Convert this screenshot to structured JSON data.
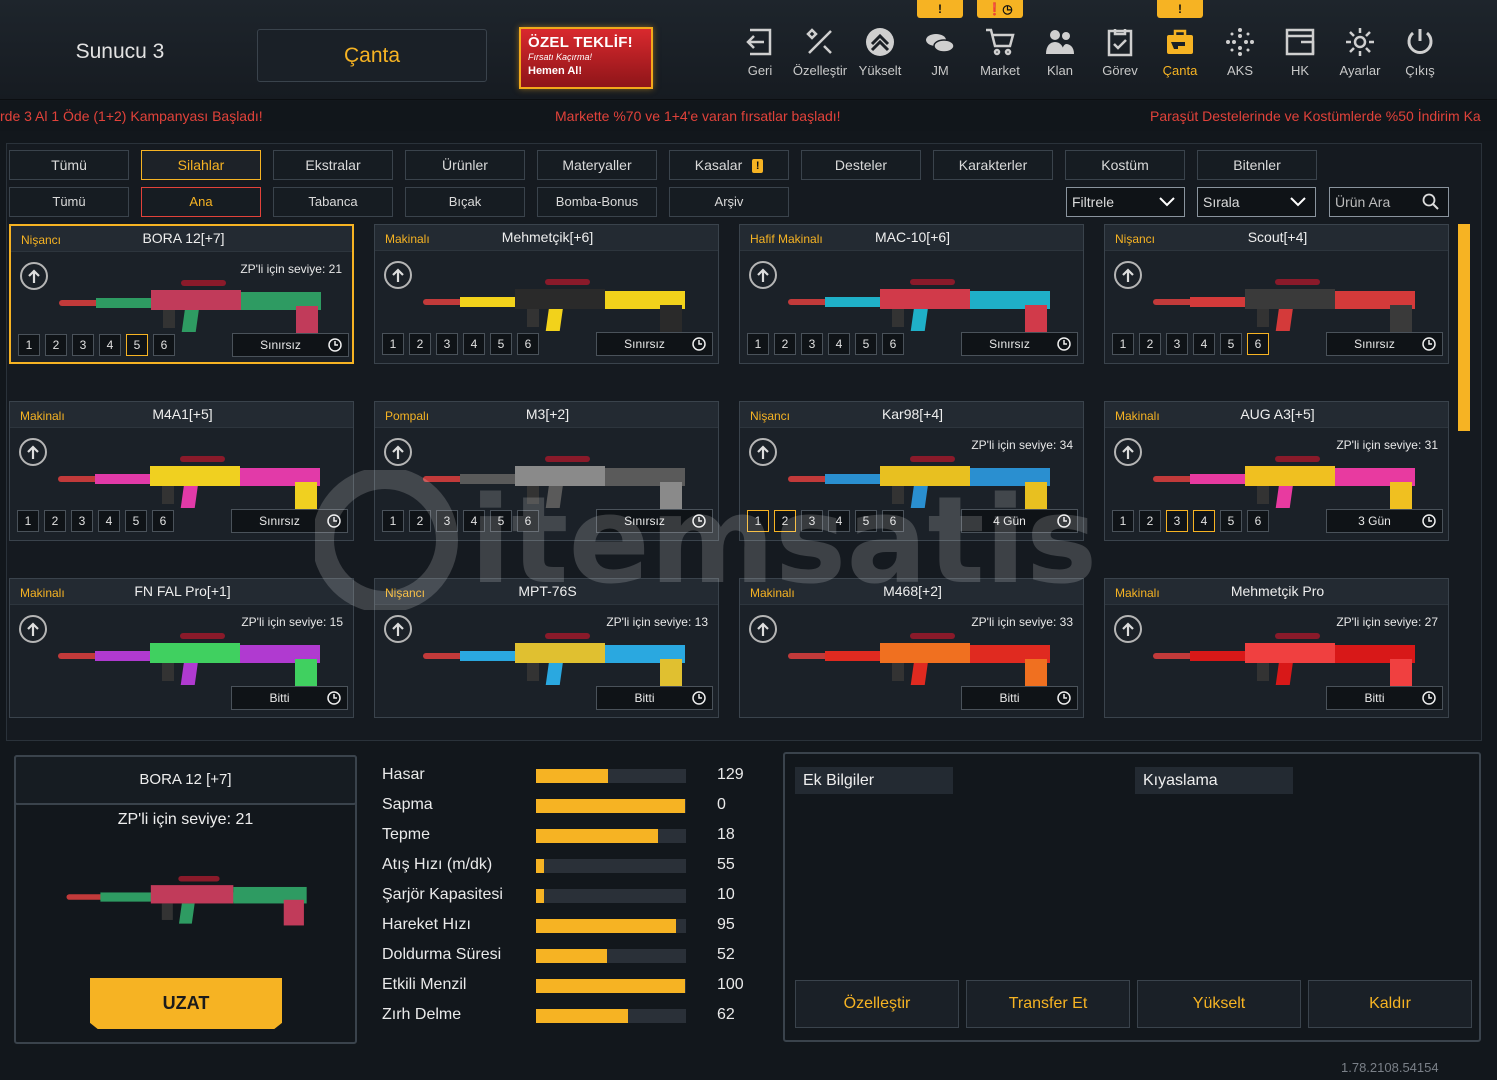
{
  "header": {
    "server": "Sunucu 3",
    "bag_button": "Çanta",
    "offer": {
      "title": "ÖZEL TEKLİF!",
      "subtitle": "Fırsatı Kaçırma!",
      "cta": "Hemen Al!"
    },
    "nav": [
      {
        "label": "Geri",
        "icon": "exit-icon"
      },
      {
        "label": "Özelleştir",
        "icon": "tools-icon"
      },
      {
        "label": "Yükselt",
        "icon": "upgrade-icon"
      },
      {
        "label": "JM",
        "icon": "coins-icon"
      },
      {
        "label": "Market",
        "icon": "cart-icon"
      },
      {
        "label": "Klan",
        "icon": "clan-icon"
      },
      {
        "label": "Görev",
        "icon": "task-icon"
      },
      {
        "label": "Çanta",
        "icon": "bag-icon"
      },
      {
        "label": "AKS",
        "icon": "aks-icon"
      },
      {
        "label": "HK",
        "icon": "hk-icon"
      },
      {
        "label": "Ayarlar",
        "icon": "gear-icon"
      },
      {
        "label": "Çıkış",
        "icon": "power-icon"
      }
    ],
    "alerts": {
      "jm": "!",
      "market": "!",
      "canta": "!"
    }
  },
  "ticker": [
    "rde 3  Al 1 Öde (1+2) Kampanyası Başladı!",
    "Markette %70 ve 1+4'e varan fırsatlar başladı!",
    "Paraşüt Destelerinde ve Kostümlerde %50 İndirim Ka"
  ],
  "tabs": [
    "Tümü",
    "Silahlar",
    "Ekstralar",
    "Ürünler",
    "Materyaller",
    "Kasalar",
    "Desteler",
    "Karakterler",
    "Kostüm",
    "Bitenler"
  ],
  "tabs_selected": "Silahlar",
  "subtabs": [
    "Tümü",
    "Ana",
    "Tabanca",
    "Bıçak",
    "Bomba-Bonus",
    "Arşiv"
  ],
  "subtabs_selected": "Ana",
  "filters": {
    "filter": "Filtrele",
    "sort": "Sırala",
    "search_placeholder": "Ürün Ara"
  },
  "items": [
    {
      "category": "Nişancı",
      "name": "BORA 12[+7]",
      "zp": "ZP'li için seviye: 21",
      "duration": "Sınırsız",
      "levels_on": [
        5
      ],
      "selected": true,
      "colors": [
        "#2e9b62",
        "#c13b5a"
      ]
    },
    {
      "category": "Makinalı",
      "name": "Mehmetçik[+6]",
      "zp": "",
      "duration": "Sınırsız",
      "levels_on": [],
      "colors": [
        "#f2d21b",
        "#2a2a2a"
      ]
    },
    {
      "category": "Hafif Makinalı",
      "name": "MAC-10[+6]",
      "zp": "",
      "duration": "Sınırsız",
      "levels_on": [],
      "colors": [
        "#1fb0c8",
        "#d13a4a"
      ]
    },
    {
      "category": "Nişancı",
      "name": "Scout[+4]",
      "zp": "",
      "duration": "Sınırsız",
      "levels_on": [
        6
      ],
      "colors": [
        "#d43a3a",
        "#3a3a3a"
      ]
    },
    {
      "category": "Makinalı",
      "name": "M4A1[+5]",
      "zp": "",
      "duration": "Sınırsız",
      "levels_on": [],
      "colors": [
        "#e23aa8",
        "#f0d020"
      ]
    },
    {
      "category": "Pompalı",
      "name": "M3[+2]",
      "zp": "",
      "duration": "Sınırsız",
      "levels_on": [],
      "colors": [
        "#5a5a5a",
        "#8a8a8a"
      ]
    },
    {
      "category": "Nişancı",
      "name": "Kar98[+4]",
      "zp": "ZP'li için seviye: 34",
      "duration": "4 Gün",
      "levels_on": [
        1,
        2
      ],
      "colors": [
        "#2a8fd0",
        "#e8c020"
      ]
    },
    {
      "category": "Makinalı",
      "name": "AUG A3[+5]",
      "zp": "ZP'li için seviye: 31",
      "duration": "3 Gün",
      "levels_on": [
        3,
        4
      ],
      "colors": [
        "#e83aa0",
        "#f0c020"
      ]
    },
    {
      "category": "Makinalı",
      "name": "FN FAL Pro[+1]",
      "zp": "ZP'li için seviye: 15",
      "duration": "Bitti",
      "levels_on": [],
      "hide_levels": true,
      "colors": [
        "#b03ad0",
        "#40d060"
      ]
    },
    {
      "category": "Nişancı",
      "name": "MPT-76S",
      "zp": "ZP'li için seviye: 13",
      "duration": "Bitti",
      "levels_on": [],
      "hide_levels": true,
      "colors": [
        "#2aa8e0",
        "#e0c030"
      ]
    },
    {
      "category": "Makinalı",
      "name": "M468[+2]",
      "zp": "ZP'li için seviye: 33",
      "duration": "Bitti",
      "levels_on": [],
      "hide_levels": true,
      "colors": [
        "#e02a20",
        "#f07020"
      ]
    },
    {
      "category": "Makinalı",
      "name": "Mehmetçik Pro",
      "zp": "ZP'li için seviye: 27",
      "duration": "Bitti",
      "levels_on": [],
      "hide_levels": true,
      "colors": [
        "#d81818",
        "#f04040"
      ]
    }
  ],
  "detail": {
    "title": "BORA 12 [+7]",
    "zp": "ZP'li için seviye: 21",
    "extend_button": "UZAT",
    "colors": [
      "#2e9b62",
      "#c13b5a"
    ]
  },
  "stats": [
    {
      "label": "Hasar",
      "value": "129",
      "fill": 0.48
    },
    {
      "label": "Sapma",
      "value": "0",
      "fill": 0.99
    },
    {
      "label": "Tepme",
      "value": "18",
      "fill": 0.81
    },
    {
      "label": "Atış Hızı (m/dk)",
      "value": "55",
      "fill": 0.05
    },
    {
      "label": "Şarjör Kapasitesi",
      "value": "10",
      "fill": 0.05
    },
    {
      "label": "Hareket Hızı",
      "value": "95",
      "fill": 0.93
    },
    {
      "label": "Doldurma Süresi",
      "value": "52",
      "fill": 0.47
    },
    {
      "label": "Etkili Menzil",
      "value": "100",
      "fill": 0.99
    },
    {
      "label": "Zırh Delme",
      "value": "62",
      "fill": 0.61
    }
  ],
  "info": {
    "extra": "Ek Bilgiler",
    "compare": "Kıyaslama"
  },
  "actions": [
    "Özelleştir",
    "Transfer Et",
    "Yükselt",
    "Kaldır"
  ],
  "version": "1.78.2108.54154",
  "watermark": "itemsatis"
}
